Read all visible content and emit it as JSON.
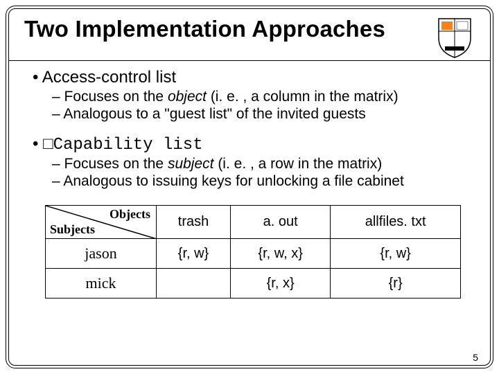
{
  "title": "Two Implementation Approaches",
  "bullet1": {
    "label": "Access-control list",
    "sub1_pre": "Focuses on the ",
    "sub1_em": "object",
    "sub1_post": " (i. e. , a column in the matrix)",
    "sub2": "Analogous to a \"guest list\" of the invited guests"
  },
  "bullet2": {
    "label_prefix": "□",
    "label": "Capability list",
    "sub1_pre": "Focuses on the ",
    "sub1_em": "subject",
    "sub1_post": " (i. e. , a row in the matrix)",
    "sub2": "Analogous to issuing keys for unlocking a file cabinet"
  },
  "table": {
    "corner_top": "Objects",
    "corner_bottom": "Subjects",
    "cols": [
      "trash",
      "a. out",
      "allfiles. txt"
    ],
    "rows": [
      {
        "subject": "jason",
        "cells": [
          "{r, w}",
          "{r, w, x}",
          "{r, w}"
        ]
      },
      {
        "subject": "mick",
        "cells": [
          "",
          "{r, x}",
          "{r}"
        ]
      }
    ]
  },
  "pagenum": "5"
}
